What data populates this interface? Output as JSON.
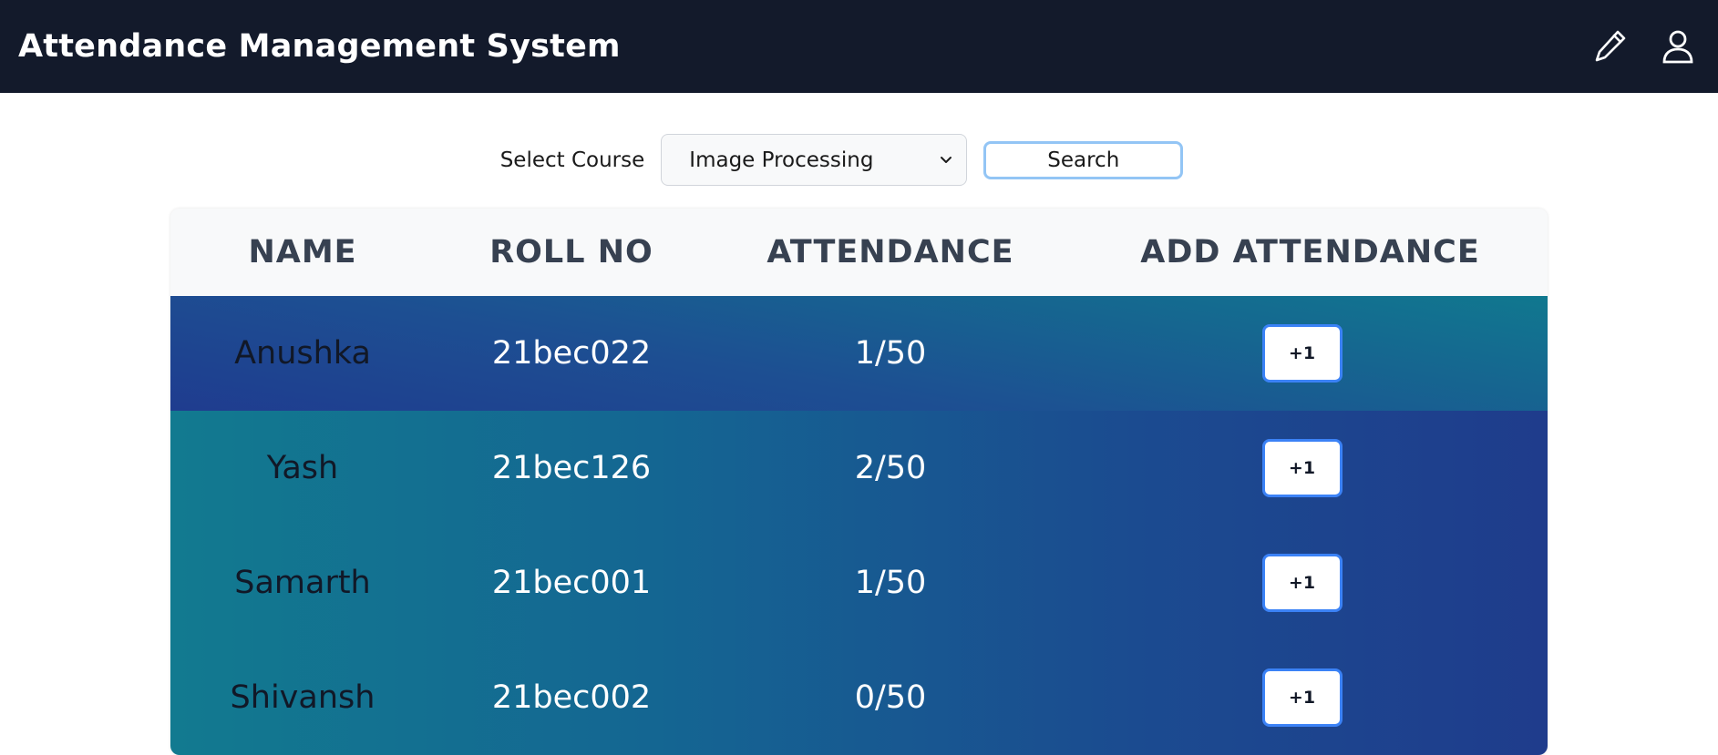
{
  "header": {
    "title": "Attendance Management System",
    "icons": [
      "pencil-icon",
      "user-icon"
    ]
  },
  "toolbar": {
    "select_label": "Select Course",
    "selected_course": "Image Processing",
    "search_label": "Search"
  },
  "table": {
    "headers": [
      "NAME",
      "ROLL NO",
      "ATTENDANCE",
      "ADD ATTENDANCE"
    ],
    "rows": [
      {
        "name": "Anushka",
        "roll": "21bec022",
        "attendance": "1/50",
        "action": "+1"
      },
      {
        "name": "Yash",
        "roll": "21bec126",
        "attendance": "2/50",
        "action": "+1"
      },
      {
        "name": "Samarth",
        "roll": "21bec001",
        "attendance": "1/50",
        "action": "+1"
      },
      {
        "name": "Shivansh",
        "roll": "21bec002",
        "attendance": "0/50",
        "action": "+1"
      }
    ]
  },
  "colors": {
    "topbar": "#131a2b",
    "header_row": "#f8f9fa",
    "row_gradient_teal": "#127a90",
    "row_gradient_blue": "#1f3c8c",
    "button_border": "#3b82f6"
  }
}
